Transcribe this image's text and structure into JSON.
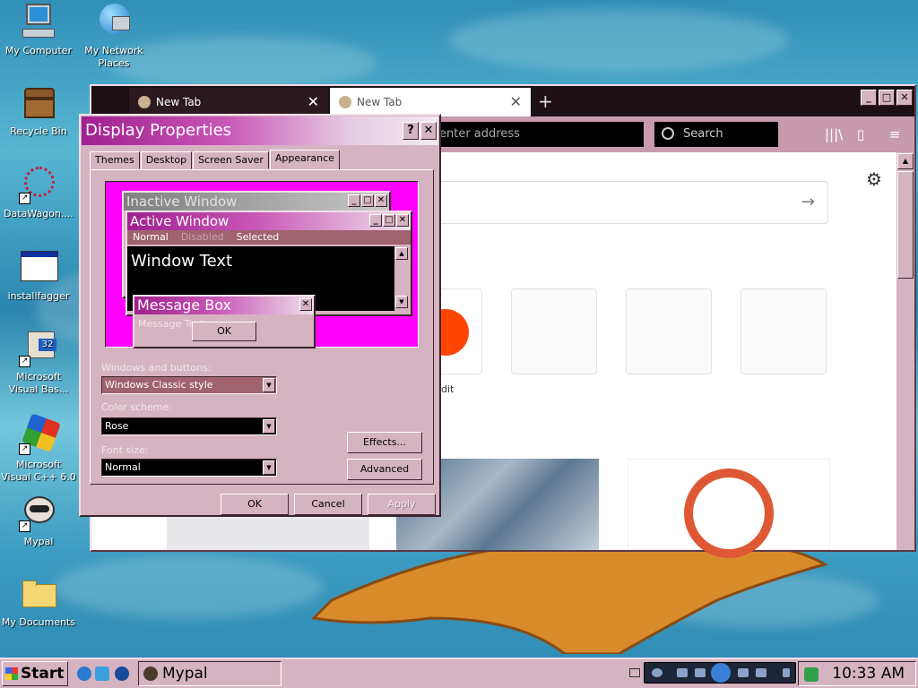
{
  "desktop": {
    "icons": [
      {
        "label": "My Computer"
      },
      {
        "label": "My Network\nPlaces"
      },
      {
        "label": "Recycle Bin"
      },
      {
        "label": "DataWagon...."
      },
      {
        "label": "installfagger"
      },
      {
        "label": "Microsoft\nVisual Bas..."
      },
      {
        "label": "Microsoft\nVisual C++ 6.0"
      },
      {
        "label": "Mypal"
      },
      {
        "label": "My Documents"
      }
    ]
  },
  "browser": {
    "tabs": [
      {
        "label": "New Tab"
      },
      {
        "label": "New Tab"
      }
    ],
    "new_tab_symbol": "+",
    "window_buttons": [
      "_",
      "□",
      "✕"
    ],
    "url_placeholder": "enter address",
    "search_placeholder": "Search",
    "top_site_label": "dit",
    "settings_symbol": "⚙"
  },
  "dialog": {
    "title": "Display Properties",
    "help_btn": "?",
    "close_btn": "✕",
    "tabs": [
      "Themes",
      "Desktop",
      "Screen Saver",
      "Appearance"
    ],
    "active_tab": "Appearance",
    "preview": {
      "inactive_title": "Inactive Window",
      "active_title": "Active Window",
      "menu_normal": "Normal",
      "menu_disabled": "Disabled",
      "menu_selected": "Selected",
      "window_text": "Window Text",
      "msgbox_title": "Message Box",
      "msgbox_text": "Message Text",
      "ok": "OK"
    },
    "fields": {
      "windows_buttons_label": "Windows and buttons:",
      "windows_buttons_value": "Windows Classic style",
      "color_scheme_label": "Color scheme:",
      "color_scheme_value": "Rose",
      "font_size_label": "Font size:",
      "font_size_value": "Normal"
    },
    "buttons": {
      "effects": "Effects...",
      "advanced": "Advanced",
      "ok": "OK",
      "cancel": "Cancel",
      "apply": "Apply"
    },
    "colors": {
      "accent": "#a0208f",
      "window_face": "#d6b3c1",
      "preview_bg": "#ff00ff"
    }
  },
  "taskbar": {
    "start_label": "Start",
    "task_label": "Mypal",
    "clock": "10:33 AM"
  }
}
